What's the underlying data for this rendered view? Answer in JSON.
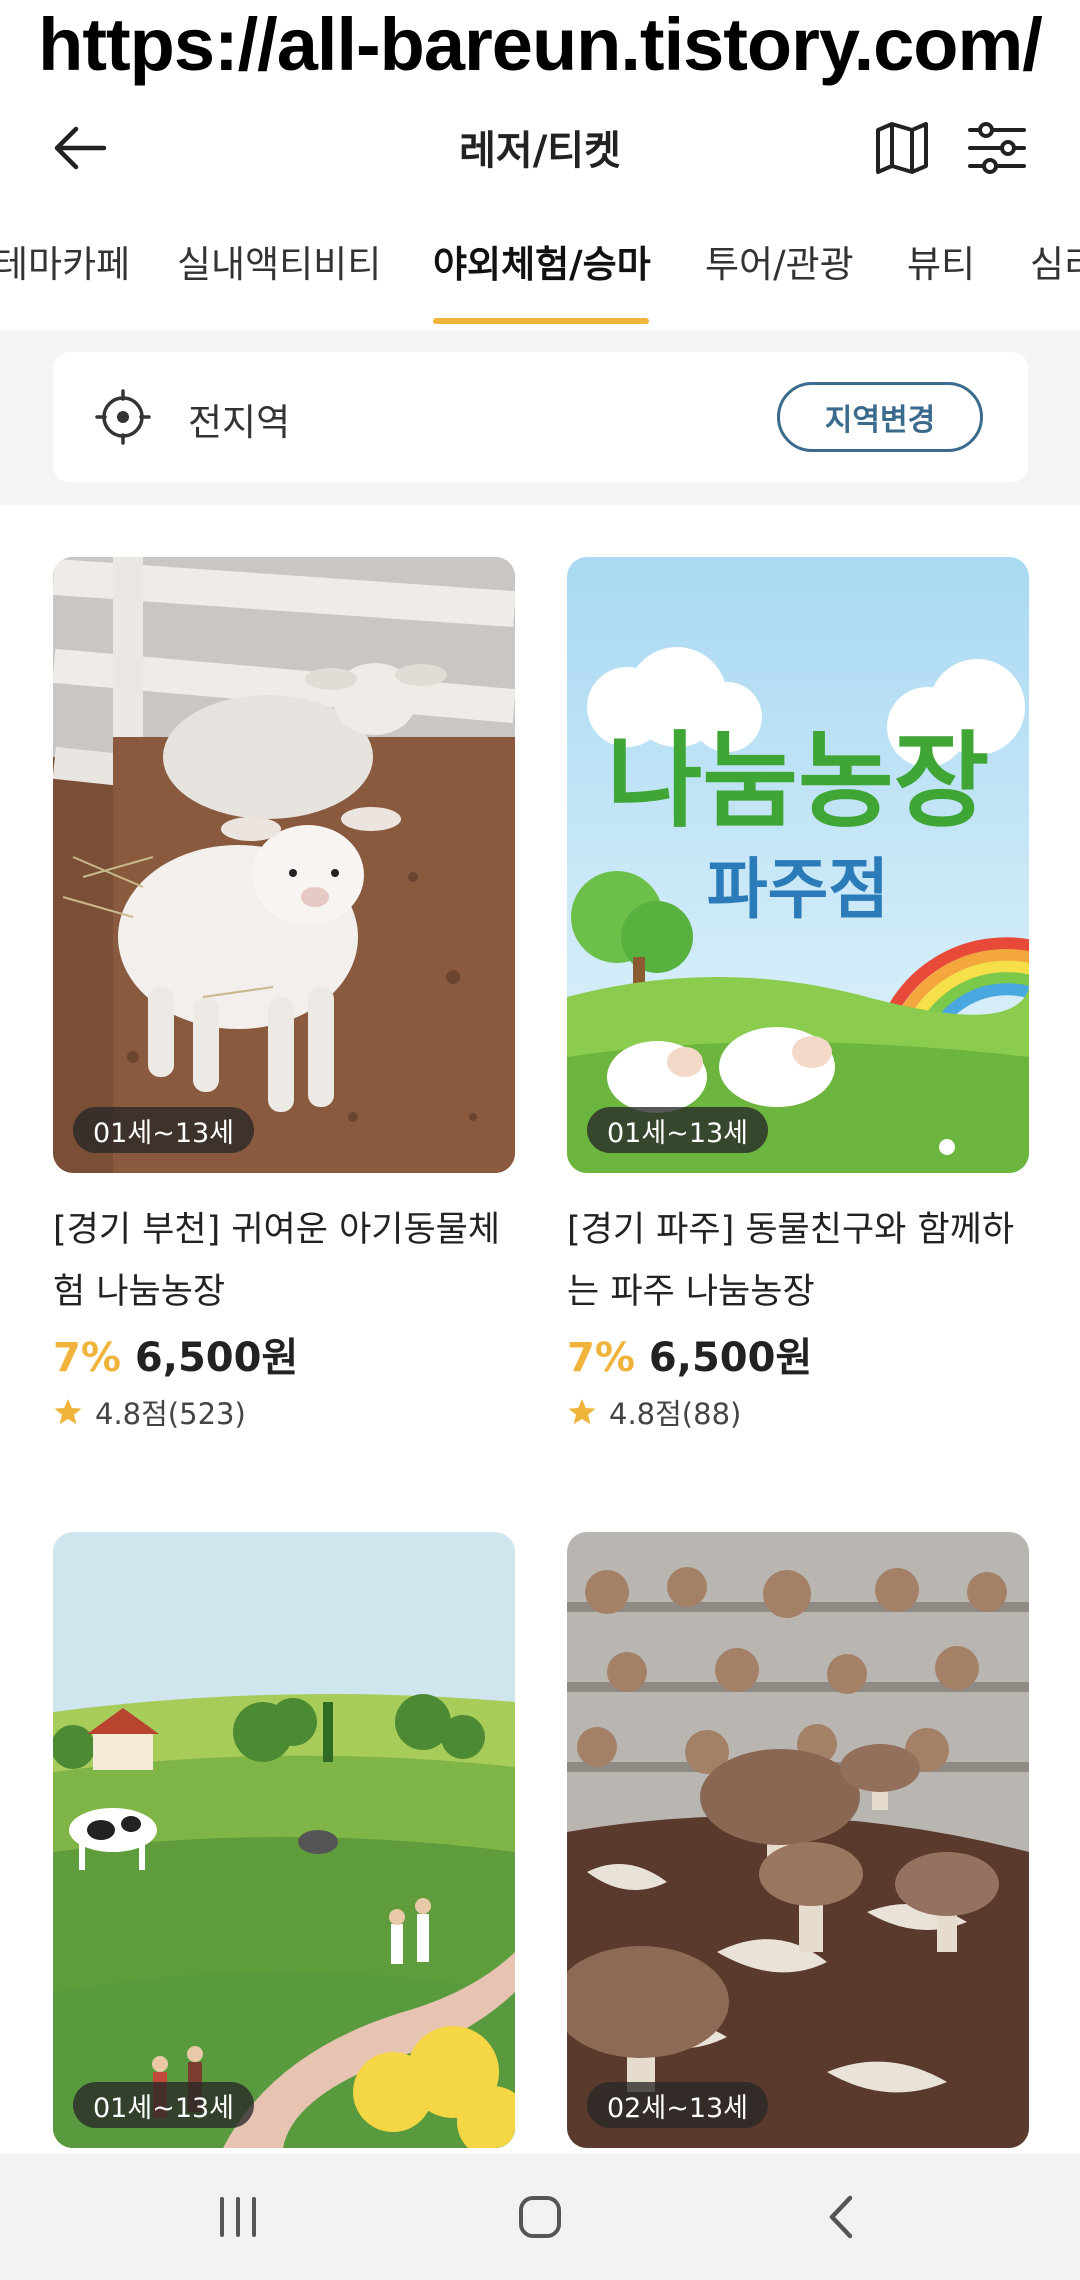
{
  "watermark": "https://all-bareun.tistory.com/",
  "header": {
    "title": "레저/티켓",
    "icons": {
      "back": "arrow-left-icon",
      "map": "map-icon",
      "filter": "sliders-icon"
    }
  },
  "tabs": [
    {
      "label": "테마카페",
      "active": false
    },
    {
      "label": "실내액티비티",
      "active": false
    },
    {
      "label": "야외체험/승마",
      "active": true
    },
    {
      "label": "투어/관광",
      "active": false
    },
    {
      "label": "뷰티",
      "active": false
    },
    {
      "label": "심리",
      "active": false
    }
  ],
  "region": {
    "label": "전지역",
    "button": "지역변경",
    "icon": "location-target-icon"
  },
  "products": [
    {
      "age": "01세~13세",
      "title": "[경기 부천] 귀여운 아기동물체험 나눔농장",
      "discount": "7%",
      "price": "6,500원",
      "rating": "4.8점(523)",
      "image": "lambs-photo"
    },
    {
      "age": "01세~13세",
      "title": "[경기 파주] 동물친구와 함께하는 파주 나눔농장",
      "discount": "7%",
      "price": "6,500원",
      "rating": "4.8점(88)",
      "image": "farm-banner",
      "image_text": {
        "line1": "나눔농장",
        "line2": "파주점"
      }
    },
    {
      "age": "01세~13세",
      "image": "farm-illustration"
    },
    {
      "age": "02세~13세",
      "image": "mushroom-photo"
    }
  ],
  "colors": {
    "accent": "#f0b43c",
    "region_button": "#3a6b8c",
    "banner_green": "#3fa535",
    "banner_blue": "#2b7bb8"
  },
  "navbar": {
    "icons": [
      "recent-apps-icon",
      "home-icon",
      "back-icon"
    ]
  }
}
